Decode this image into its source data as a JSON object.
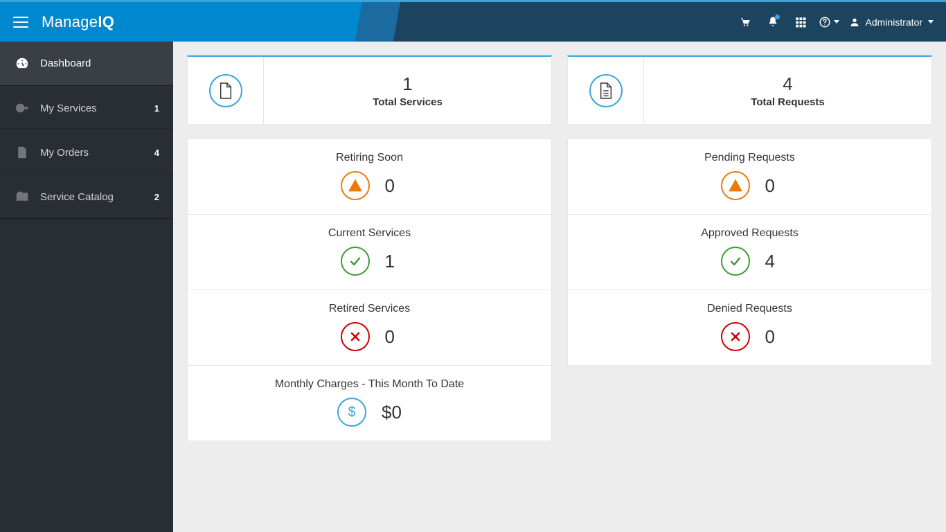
{
  "brand": {
    "part1": "Manage",
    "part2": "IQ"
  },
  "header": {
    "user_label": "Administrator"
  },
  "sidebar": {
    "items": [
      {
        "label": "Dashboard",
        "badge": ""
      },
      {
        "label": "My Services",
        "badge": "1"
      },
      {
        "label": "My Orders",
        "badge": "4"
      },
      {
        "label": "Service Catalog",
        "badge": "2"
      }
    ]
  },
  "left_col": {
    "summary": {
      "value": "1",
      "label": "Total Services"
    },
    "stats": [
      {
        "title": "Retiring Soon",
        "value": "0",
        "kind": "warn"
      },
      {
        "title": "Current Services",
        "value": "1",
        "kind": "ok"
      },
      {
        "title": "Retired Services",
        "value": "0",
        "kind": "err"
      },
      {
        "title": "Monthly Charges - This Month To Date",
        "value": "$0",
        "kind": "money"
      }
    ]
  },
  "right_col": {
    "summary": {
      "value": "4",
      "label": "Total Requests"
    },
    "stats": [
      {
        "title": "Pending Requests",
        "value": "0",
        "kind": "warn"
      },
      {
        "title": "Approved Requests",
        "value": "4",
        "kind": "ok"
      },
      {
        "title": "Denied Requests",
        "value": "0",
        "kind": "err"
      }
    ]
  }
}
